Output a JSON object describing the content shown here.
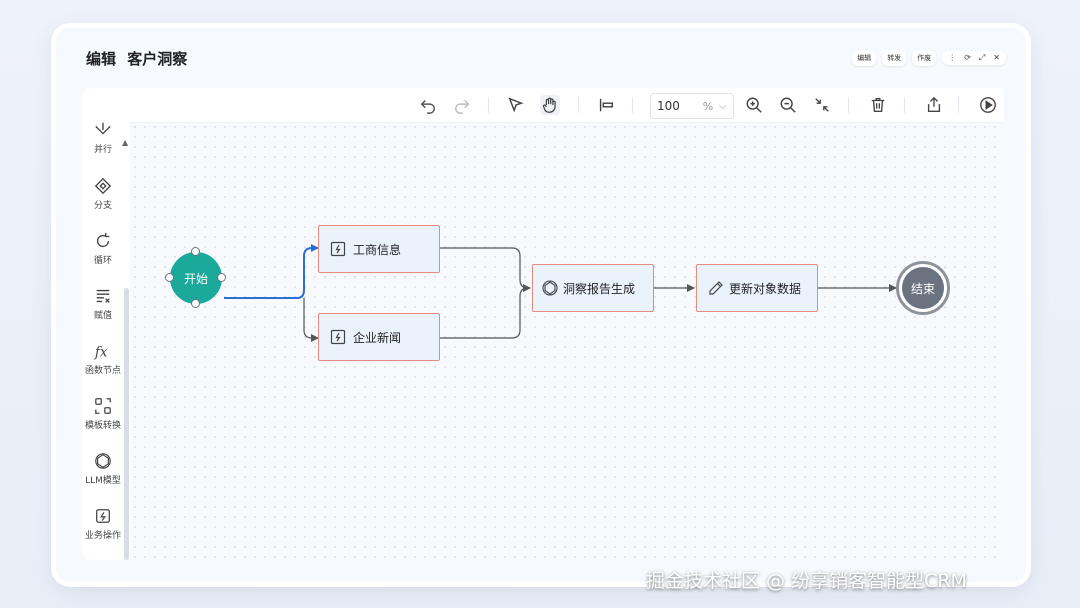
{
  "window": {
    "title_prefix": "编辑",
    "title_name": "客户洞察",
    "actions": [
      "编辑",
      "转发",
      "作废"
    ],
    "controls": [
      "⋮",
      "⟳",
      "⤢",
      "✕"
    ]
  },
  "toolbar": {
    "zoom_value": "100",
    "zoom_unit": "%",
    "icons": [
      "undo-icon",
      "redo-icon",
      "select-icon",
      "hand-icon",
      "align-icon",
      "zoom-in-icon",
      "zoom-out-icon",
      "fit-icon",
      "delete-icon",
      "export-icon",
      "run-icon"
    ]
  },
  "sidebar": {
    "items": [
      {
        "label": "并行",
        "icon": "parallel-icon"
      },
      {
        "label": "分支",
        "icon": "branch-icon"
      },
      {
        "label": "循环",
        "icon": "loop-icon"
      },
      {
        "label": "赋值",
        "icon": "assign-icon"
      },
      {
        "label": "函数节点",
        "icon": "function-icon"
      },
      {
        "label": "模板转换",
        "icon": "template-icon"
      },
      {
        "label": "LLM模型",
        "icon": "llm-icon"
      },
      {
        "label": "业务操作",
        "icon": "business-icon"
      }
    ]
  },
  "flow": {
    "start_label": "开始",
    "end_label": "结束",
    "nodes": [
      {
        "id": "biz-info",
        "label": "工商信息",
        "icon": "plugin-icon"
      },
      {
        "id": "news",
        "label": "企业新闻",
        "icon": "plugin-icon"
      },
      {
        "id": "report",
        "label": "洞察报告生成",
        "icon": "llm-icon"
      },
      {
        "id": "update",
        "label": "更新对象数据",
        "icon": "pencil-icon"
      }
    ]
  },
  "colors": {
    "start": "#1aa99a",
    "end": "#6b7280",
    "node_border": "#e58b7f",
    "node_fill": "#eaf2fc",
    "active_edge": "#2b6fd6"
  },
  "watermark": "掘金技术社区 @ 纷享销客智能型CRM"
}
